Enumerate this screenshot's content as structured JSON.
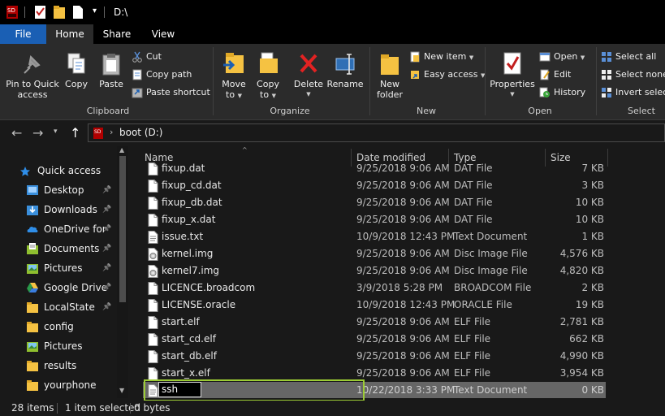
{
  "window": {
    "title": "D:\\"
  },
  "ribbon_tabs": [
    "File",
    "Home",
    "Share",
    "View"
  ],
  "ribbon": {
    "clipboard": {
      "pin": [
        "Pin to Quick",
        "access"
      ],
      "copy": "Copy",
      "paste": "Paste",
      "cut": "Cut",
      "copy_path": "Copy path",
      "paste_shortcut": "Paste shortcut",
      "group": "Clipboard"
    },
    "organize": {
      "move_to": [
        "Move",
        "to"
      ],
      "copy_to": [
        "Copy",
        "to"
      ],
      "delete": "Delete",
      "rename": "Rename",
      "group": "Organize"
    },
    "new": {
      "new_folder": [
        "New",
        "folder"
      ],
      "new_item": "New item",
      "easy_access": "Easy access",
      "group": "New"
    },
    "open": {
      "properties": "Properties",
      "open": "Open",
      "edit": "Edit",
      "history": "History",
      "group": "Open"
    },
    "select": {
      "select_all": "Select all",
      "select_none": "Select none",
      "invert": "Invert select",
      "group": "Select"
    }
  },
  "address": {
    "crumb": "boot (D:)"
  },
  "nav_pane": [
    {
      "label": "Quick access",
      "icon": "star-icon",
      "pinned": false
    },
    {
      "label": "Desktop",
      "icon": "desktop-folder-icon",
      "pinned": true
    },
    {
      "label": "Downloads",
      "icon": "download-folder-icon",
      "pinned": true
    },
    {
      "label": "OneDrive for",
      "icon": "onedrive-icon",
      "pinned": true
    },
    {
      "label": "Documents",
      "icon": "documents-folder-icon",
      "pinned": true
    },
    {
      "label": "Pictures",
      "icon": "pictures-folder-icon",
      "pinned": true
    },
    {
      "label": "Google Drive",
      "icon": "google-drive-icon",
      "pinned": true
    },
    {
      "label": "LocalState",
      "icon": "folder-icon",
      "pinned": true
    },
    {
      "label": "config",
      "icon": "folder-icon",
      "pinned": false
    },
    {
      "label": "Pictures",
      "icon": "pictures-folder-icon",
      "pinned": false
    },
    {
      "label": "results",
      "icon": "folder-icon",
      "pinned": false
    },
    {
      "label": "yourphone",
      "icon": "folder-icon",
      "pinned": false
    }
  ],
  "columns": {
    "name": "Name",
    "date": "Date modified",
    "type": "Type",
    "size": "Size"
  },
  "files": [
    {
      "name": "fixup.dat",
      "date": "9/25/2018 9:06 AM",
      "type": "DAT File",
      "size": "7 KB",
      "icon": "file-icon"
    },
    {
      "name": "fixup_cd.dat",
      "date": "9/25/2018 9:06 AM",
      "type": "DAT File",
      "size": "3 KB",
      "icon": "file-icon"
    },
    {
      "name": "fixup_db.dat",
      "date": "9/25/2018 9:06 AM",
      "type": "DAT File",
      "size": "10 KB",
      "icon": "file-icon"
    },
    {
      "name": "fixup_x.dat",
      "date": "9/25/2018 9:06 AM",
      "type": "DAT File",
      "size": "10 KB",
      "icon": "file-icon"
    },
    {
      "name": "issue.txt",
      "date": "10/9/2018 12:43 PM",
      "type": "Text Document",
      "size": "1 KB",
      "icon": "text-file-icon"
    },
    {
      "name": "kernel.img",
      "date": "9/25/2018 9:06 AM",
      "type": "Disc Image File",
      "size": "4,576 KB",
      "icon": "disc-image-icon"
    },
    {
      "name": "kernel7.img",
      "date": "9/25/2018 9:06 AM",
      "type": "Disc Image File",
      "size": "4,820 KB",
      "icon": "disc-image-icon"
    },
    {
      "name": "LICENCE.broadcom",
      "date": "3/9/2018 5:28 PM",
      "type": "BROADCOM File",
      "size": "2 KB",
      "icon": "file-icon"
    },
    {
      "name": "LICENSE.oracle",
      "date": "10/9/2018 12:43 PM",
      "type": "ORACLE File",
      "size": "19 KB",
      "icon": "file-icon"
    },
    {
      "name": "start.elf",
      "date": "9/25/2018 9:06 AM",
      "type": "ELF File",
      "size": "2,781 KB",
      "icon": "file-icon"
    },
    {
      "name": "start_cd.elf",
      "date": "9/25/2018 9:06 AM",
      "type": "ELF File",
      "size": "662 KB",
      "icon": "file-icon"
    },
    {
      "name": "start_db.elf",
      "date": "9/25/2018 9:06 AM",
      "type": "ELF File",
      "size": "4,990 KB",
      "icon": "file-icon"
    },
    {
      "name": "start_x.elf",
      "date": "9/25/2018 9:06 AM",
      "type": "ELF File",
      "size": "3,954 KB",
      "icon": "file-icon"
    },
    {
      "name": "ssh",
      "date": "10/22/2018 3:33 PM",
      "type": "Text Document",
      "size": "0 KB",
      "icon": "text-file-icon",
      "selected": true,
      "renaming": true
    }
  ],
  "status": {
    "items": "28 items",
    "selected": "1 item selected",
    "size": "0 bytes"
  },
  "colors": {
    "accent": "#1a5fb4",
    "selection_outline": "#9ccc34",
    "selected_row": "#666666"
  }
}
